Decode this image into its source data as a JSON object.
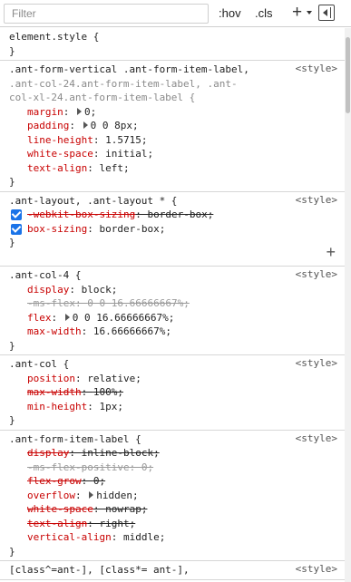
{
  "toolbar": {
    "filter_placeholder": "Filter",
    "hov_label": ":hov",
    "cls_label": ".cls"
  },
  "rules": [
    {
      "selector_parts": [
        {
          "text": "element.style {",
          "dim": false
        }
      ],
      "origin": "",
      "declarations": []
    },
    {
      "selector_parts": [
        {
          "text": ".ant-form-vertical .ant-form-item-label,",
          "dim": false
        },
        {
          "text": ".ant-col-24.ant-form-item-label, .ant-",
          "dim": true
        },
        {
          "text": "col-xl-24.ant-form-item-label {",
          "dim": true
        }
      ],
      "origin": "<style>",
      "declarations": [
        {
          "name": "margin",
          "value": "0;",
          "expand": true,
          "strike": false,
          "disabled": false,
          "checkbox": false
        },
        {
          "name": "padding",
          "value": "0 0 8px;",
          "expand": true,
          "strike": false,
          "disabled": false,
          "checkbox": false
        },
        {
          "name": "line-height",
          "value": "1.5715;",
          "expand": false,
          "strike": false,
          "disabled": false,
          "checkbox": false
        },
        {
          "name": "white-space",
          "value": "initial;",
          "expand": false,
          "strike": false,
          "disabled": false,
          "checkbox": false
        },
        {
          "name": "text-align",
          "value": "left;",
          "expand": false,
          "strike": false,
          "disabled": false,
          "checkbox": false
        }
      ]
    },
    {
      "selector_parts": [
        {
          "text": ".ant-layout, .ant-layout * {",
          "dim": false
        }
      ],
      "origin": "<style>",
      "declarations": [
        {
          "name": "-webkit-box-sizing",
          "value": "border-box;",
          "expand": false,
          "strike": true,
          "disabled": false,
          "checkbox": true
        },
        {
          "name": "box-sizing",
          "value": "border-box;",
          "expand": false,
          "strike": false,
          "disabled": false,
          "checkbox": true
        }
      ],
      "has_add": true
    },
    {
      "selector_parts": [
        {
          "text": ".ant-col-4 {",
          "dim": false
        }
      ],
      "origin": "<style>",
      "declarations": [
        {
          "name": "display",
          "value": "block;",
          "expand": false,
          "strike": false,
          "disabled": false,
          "checkbox": false
        },
        {
          "name": "-ms-flex",
          "value": "0 0 16.66666667%;",
          "expand": false,
          "strike": true,
          "disabled": true,
          "checkbox": false
        },
        {
          "name": "flex",
          "value": "0 0 16.66666667%;",
          "expand": true,
          "strike": false,
          "disabled": false,
          "checkbox": false
        },
        {
          "name": "max-width",
          "value": "16.66666667%;",
          "expand": false,
          "strike": false,
          "disabled": false,
          "checkbox": false
        }
      ]
    },
    {
      "selector_parts": [
        {
          "text": ".ant-col {",
          "dim": false
        }
      ],
      "origin": "<style>",
      "declarations": [
        {
          "name": "position",
          "value": "relative;",
          "expand": false,
          "strike": false,
          "disabled": false,
          "checkbox": false
        },
        {
          "name": "max-width",
          "value": "100%;",
          "expand": false,
          "strike": true,
          "disabled": false,
          "checkbox": false
        },
        {
          "name": "min-height",
          "value": "1px;",
          "expand": false,
          "strike": false,
          "disabled": false,
          "checkbox": false
        }
      ]
    },
    {
      "selector_parts": [
        {
          "text": ".ant-form-item-label {",
          "dim": false
        }
      ],
      "origin": "<style>",
      "declarations": [
        {
          "name": "display",
          "value": "inline-block;",
          "expand": false,
          "strike": true,
          "disabled": false,
          "checkbox": false
        },
        {
          "name": "-ms-flex-positive",
          "value": "0;",
          "expand": false,
          "strike": true,
          "disabled": true,
          "checkbox": false
        },
        {
          "name": "flex-grow",
          "value": "0;",
          "expand": false,
          "strike": true,
          "disabled": false,
          "checkbox": false
        },
        {
          "name": "overflow",
          "value": "hidden;",
          "expand": true,
          "strike": false,
          "disabled": false,
          "checkbox": false
        },
        {
          "name": "white-space",
          "value": "nowrap;",
          "expand": false,
          "strike": true,
          "disabled": false,
          "checkbox": false
        },
        {
          "name": "text-align",
          "value": "right;",
          "expand": false,
          "strike": true,
          "disabled": false,
          "checkbox": false
        },
        {
          "name": "vertical-align",
          "value": "middle;",
          "expand": false,
          "strike": false,
          "disabled": false,
          "checkbox": false
        }
      ]
    },
    {
      "selector_parts": [
        {
          "text": "[class^=ant-], [class*= ant-],",
          "dim": false
        }
      ],
      "origin": "<style>",
      "declarations": [],
      "no_close": true
    }
  ]
}
